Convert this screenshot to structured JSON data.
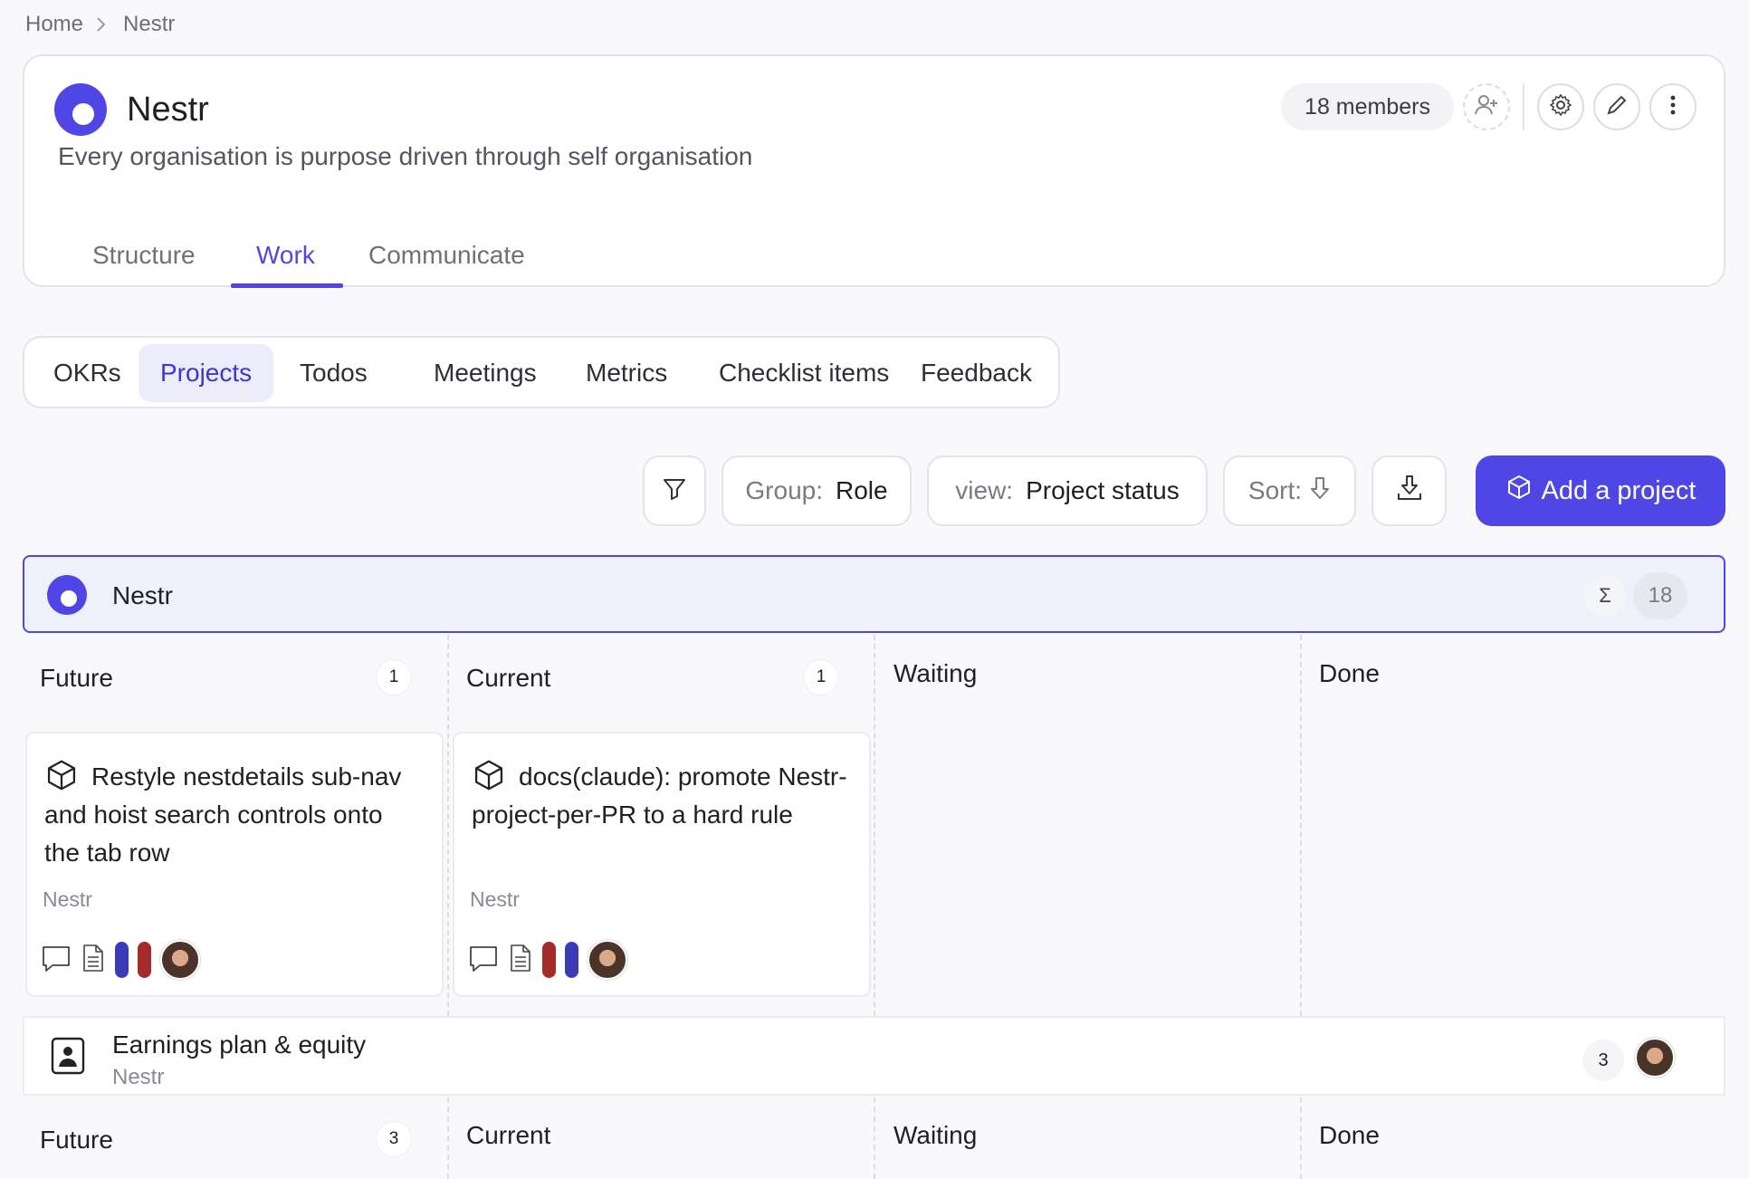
{
  "breadcrumb": {
    "home": "Home",
    "current": "Nestr"
  },
  "header": {
    "org_name": "Nestr",
    "purpose": "Every organisation is purpose driven through self organisation",
    "members_label": "18 members",
    "tabs": [
      "Structure",
      "Work",
      "Communicate"
    ],
    "active_tab": "Work"
  },
  "sub_nav": {
    "items": [
      "OKRs",
      "Projects",
      "Todos",
      "Meetings",
      "Metrics",
      "Checklist items",
      "Feedback"
    ],
    "active": "Projects"
  },
  "toolbar": {
    "group_label": "Group:",
    "group_value": "Role",
    "view_label": "view:",
    "view_value": "Project status",
    "sort_label": "Sort:",
    "add_label": "Add a project"
  },
  "group": {
    "name": "Nestr",
    "total": "18"
  },
  "columns": [
    {
      "title": "Future",
      "count": "1"
    },
    {
      "title": "Current",
      "count": "1"
    },
    {
      "title": "Waiting",
      "count": ""
    },
    {
      "title": "Done",
      "count": ""
    }
  ],
  "cards": [
    {
      "title": "Restyle nestdetails sub-nav and hoist search controls onto the tab row",
      "org": "Nestr",
      "pills": [
        "#3b3bb8",
        "#a52a2a"
      ]
    },
    {
      "title": "docs(claude): promote Nestr-project-per-PR to a hard rule",
      "org": "Nestr",
      "pills": [
        "#a52a2a",
        "#3b3bb8"
      ]
    }
  ],
  "role": {
    "name": "Earnings plan & equity",
    "org": "Nestr",
    "count": "3"
  },
  "role_columns": [
    {
      "title": "Future",
      "count": "3"
    },
    {
      "title": "Current",
      "count": ""
    },
    {
      "title": "Waiting",
      "count": ""
    },
    {
      "title": "Done",
      "count": ""
    }
  ],
  "colors": {
    "accent": "#4f46e5",
    "group_bg": "#eef0fb"
  }
}
